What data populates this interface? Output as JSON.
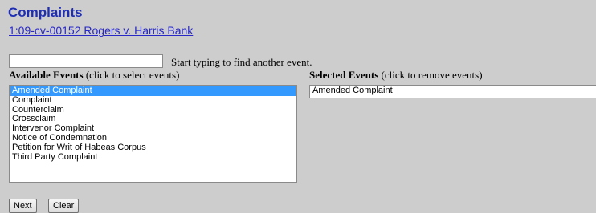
{
  "page": {
    "title": "Complaints",
    "case_link": "1:09-cv-00152 Rogers v. Harris Bank"
  },
  "search": {
    "value": "",
    "hint": "Start typing to find another event."
  },
  "available": {
    "label_bold": "Available Events",
    "label_rest": " (click to select events)",
    "items": [
      {
        "label": "Amended Complaint",
        "selected": true
      },
      {
        "label": "Complaint",
        "selected": false
      },
      {
        "label": "Counterclaim",
        "selected": false
      },
      {
        "label": "Crossclaim",
        "selected": false
      },
      {
        "label": "Intervenor Complaint",
        "selected": false
      },
      {
        "label": "Notice of Condemnation",
        "selected": false
      },
      {
        "label": "Petition for Writ of Habeas Corpus",
        "selected": false
      },
      {
        "label": "Third Party Complaint",
        "selected": false
      }
    ]
  },
  "selected": {
    "label_bold": "Selected Events",
    "label_rest": " (click to remove events)",
    "items": [
      {
        "label": "Amended Complaint"
      }
    ]
  },
  "buttons": {
    "next": "Next",
    "clear": "Clear"
  }
}
